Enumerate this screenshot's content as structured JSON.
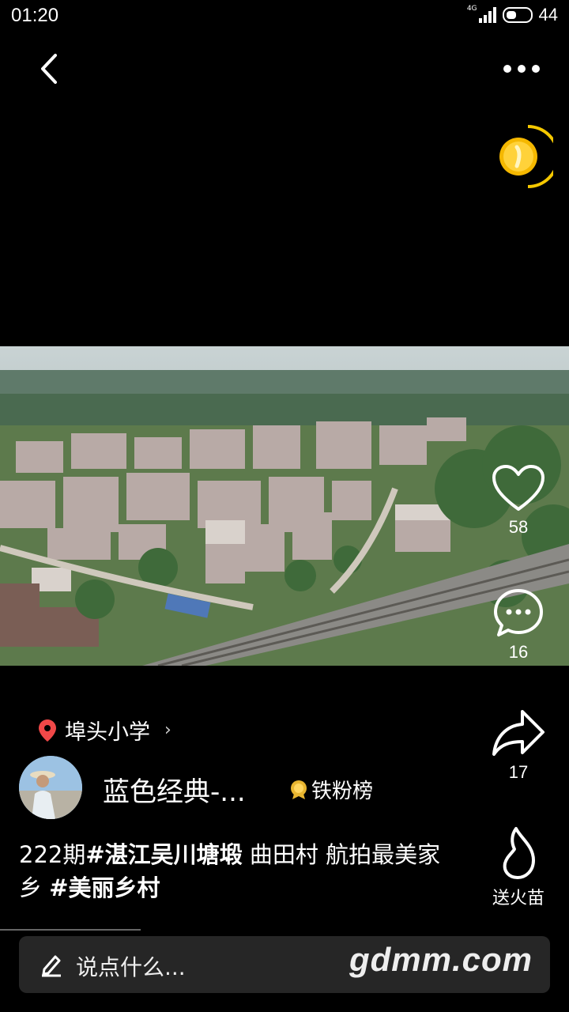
{
  "status": {
    "time": "01:20",
    "network": "4G",
    "battery": "44"
  },
  "actions": {
    "likes": "58",
    "comments": "16",
    "shares": "17",
    "fire_label": "送火苗"
  },
  "post": {
    "location": "埠头小学",
    "author": "蓝色经典-...",
    "fans_badge": "铁粉榜",
    "caption": [
      {
        "text": "222期",
        "bold": false
      },
      {
        "text": "#湛江吴川塘塅",
        "bold": true
      },
      {
        "text": " 曲田村  航拍最美家乡 ",
        "bold": false
      },
      {
        "text": "#美丽乡村",
        "bold": true
      }
    ]
  },
  "comment_bar": {
    "placeholder": "说点什么...",
    "watermark": "gdmm.com"
  },
  "icons": {
    "back": "chevron-left-icon",
    "more": "more-dots-icon",
    "like": "heart-icon",
    "comment": "comment-bubble-icon",
    "share": "share-arrow-icon",
    "fire": "flame-icon",
    "location": "location-pin-icon",
    "pen": "pen-icon"
  },
  "colors": {
    "background": "#000000",
    "coin": "#f5b800",
    "pin": "#f04848",
    "comment_bar": "#262626"
  }
}
